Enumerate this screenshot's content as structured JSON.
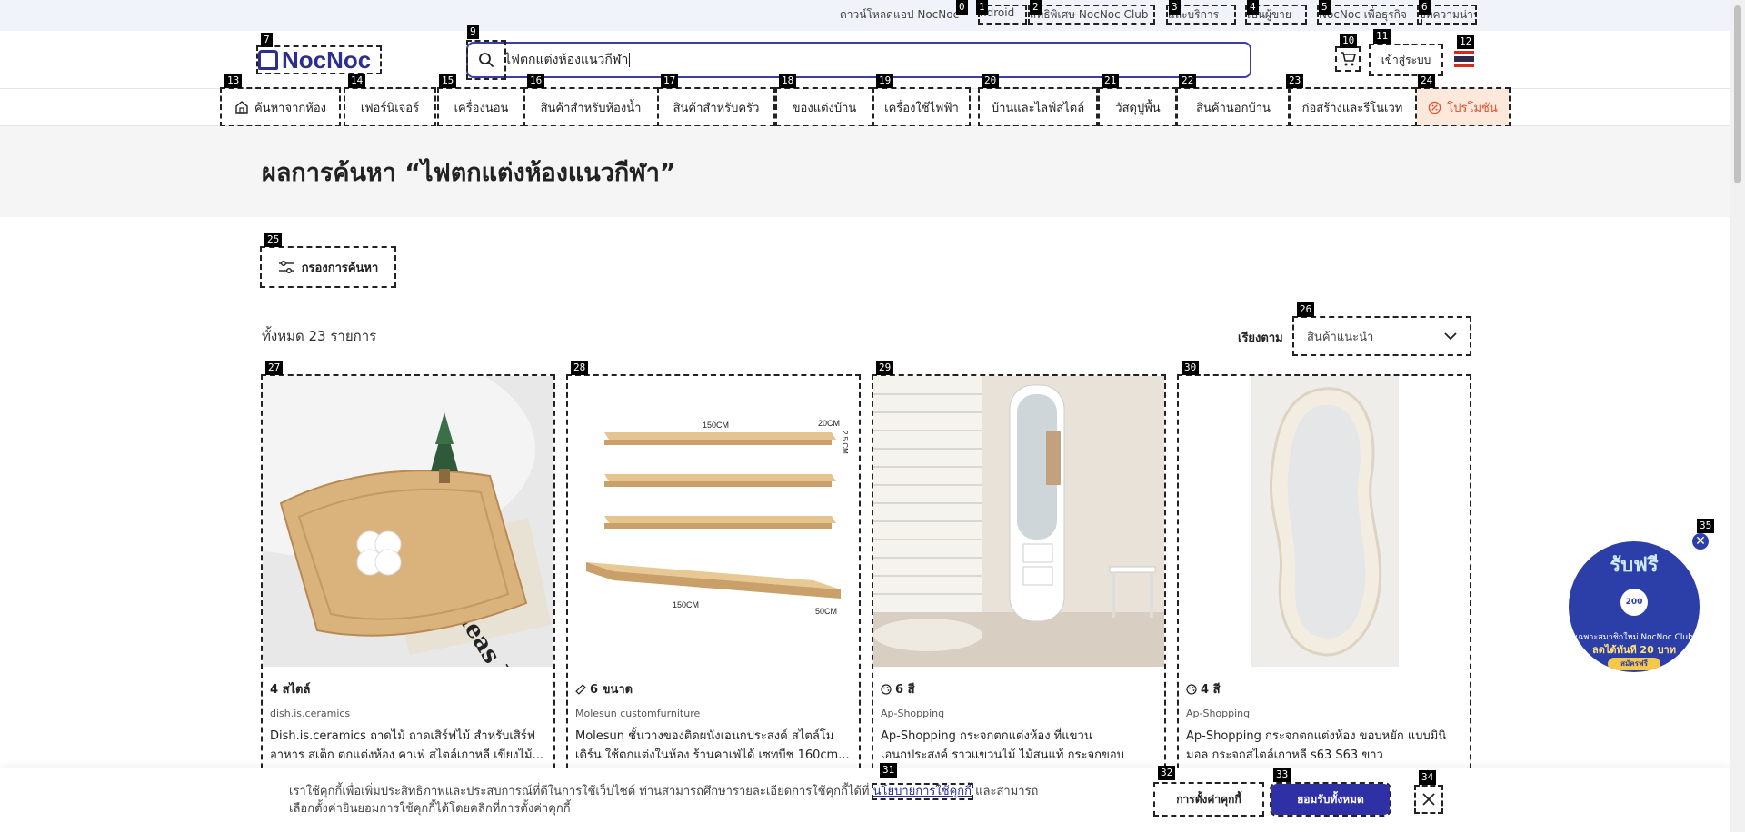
{
  "topbar": {
    "download_app": "ดาวน์โหลดแอป NocNoc",
    "links": [
      "ndroid",
      "สิทธิพิเศษ NocNoc Club",
      "และบริการ",
      "เป็นผู้ขาย",
      "NocNoc เพื่อธุรกิจ",
      "บทความน่าร"
    ]
  },
  "header": {
    "logo": "NocNoc",
    "search_value": "ไฟตกแต่งห้องแนวกีฬา",
    "login_label": "เข้าสู่ระบบ"
  },
  "categories": [
    "ค้นหาจากห้อง",
    "เฟอร์นิเจอร์",
    "เครื่องนอน",
    "สินค้าสำหรับห้องน้ำ",
    "สินค้าสำหรับครัว",
    "ของแต่งบ้าน",
    "เครื่องใช้ไฟฟ้า",
    "บ้านและไลฟ์สไตล์",
    "วัสดุปูพื้น",
    "สินค้านอกบ้าน",
    "ก่อสร้างและรีโนเวท",
    "โปรโมชัน"
  ],
  "results": {
    "title": "ผลการค้นหา “ไฟตกแต่งห้องแนวกีฬา”",
    "filter_label": "กรองการค้นหา",
    "count_text": "ทั้งหมด 23 รายการ",
    "sort_label": "เรียงตาม",
    "sort_value": "สินค้าแนะนำ"
  },
  "products": [
    {
      "variant": "4 สไตล์",
      "shop": "dish.is.ceramics",
      "name": "Dish.is.ceramics ถาดไม้ ถาดเสิร์ฟไม้ สำหรับเสิร์ฟอาหาร สเต็ก ตกแต่งห้อง คาเฟ่ สไตล์เกาหลี เขียงไม้..."
    },
    {
      "variant": "6 ขนาด",
      "shop": "Molesun customfurniture",
      "name": "Molesun ชั้นวางของติดผนังเอนกประสงค์ สไตล์โมเดิร์น ใช้ตกแต่งในห้อง ร้านคาเฟ่ได้ เซทบีช 160cm..."
    },
    {
      "variant": "6 สี",
      "shop": "Ap-Shopping",
      "name": "Ap-Shopping กระจกตกแต่งห้อง ที่แขวนเอนกประสงค์ ราวแขวนไม้ ไม้สนแท้ กระจกขอบหยัก..."
    },
    {
      "variant": "4 สี",
      "shop": "Ap-Shopping",
      "name": "Ap-Shopping กระจกตกแต่งห้อง ขอบหยัก แบบมินิมอล กระจกสไตล์เกาหลี s63 S63 ขาว"
    }
  ],
  "image_text": {
    "shelf_top_width": "150CM",
    "shelf_top_depth": "20CM",
    "shelf_thickness": "2.5 CM",
    "shelf_bottom_width": "150CM",
    "shelf_bottom_depth": "50CM",
    "newspaper": "Ideas News"
  },
  "cookie": {
    "message_before": "เราใช้คุกกี้เพื่อเพิ่มประสิทธิภาพและประสบการณ์ที่ดีในการใช้เว็บไซต์ ท่านสามารถศึกษารายละเอียดการใช้คุกกี้ได้ที่ ",
    "policy_link": "นโยบายการใช้คุกกี้",
    "message_after": " และสามารถเลือกตั้งค่ายินยอมการใช้คุกกี้ได้โดยคลิกที่การตั้งค่าคุกกี้",
    "settings_label": "การตั้งค่าคุกกี้",
    "accept_label": "ยอมรับทั้งหมด"
  },
  "promo_badge": {
    "title": "รับฟรี",
    "coin": "200",
    "subtitle": "เฉพาะสมาชิกใหม่ NocNoc Club",
    "discount": "ลดได้ทันที 20 บาท",
    "cta": "สมัครฟรี"
  },
  "markers": [
    "0",
    "1",
    "2",
    "3",
    "4",
    "5",
    "6",
    "7",
    "9",
    "10",
    "11",
    "12",
    "13",
    "14",
    "15",
    "16",
    "17",
    "18",
    "19",
    "20",
    "21",
    "22",
    "23",
    "24",
    "25",
    "26",
    "27",
    "28",
    "29",
    "30",
    "31",
    "32",
    "33",
    "34",
    "35"
  ],
  "colors": {
    "brand": "#2c2f8f",
    "accept_button": "#2f2fa6",
    "promo_text": "#e4502b",
    "promo_bg": "#fde9dc",
    "title_band": "#f5f5f5"
  }
}
